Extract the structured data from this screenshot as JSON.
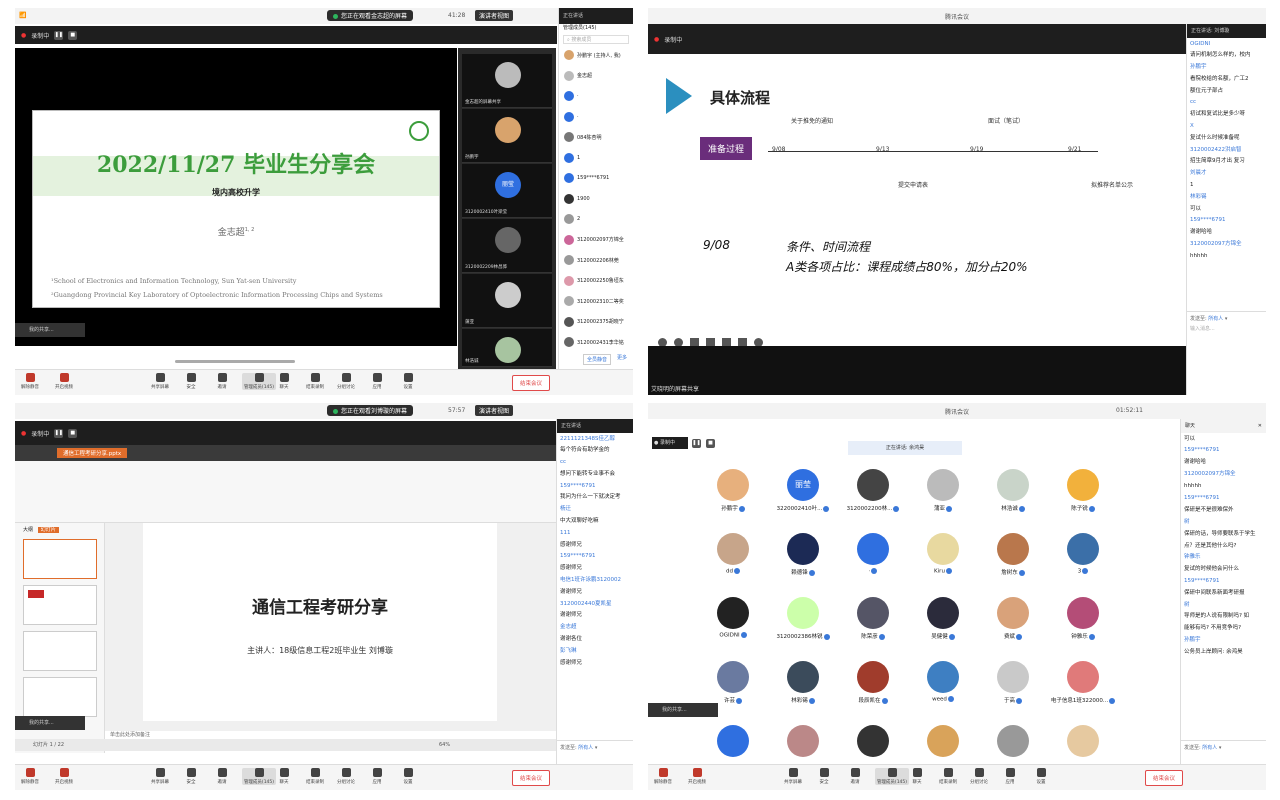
{
  "q1": {
    "share_banner": "您正在观看金志超的屏幕",
    "timer": "41:28",
    "view_btn": "演讲者视图",
    "rec_label": "录制中",
    "slide": {
      "title": "2022/11/27 毕业生分享会",
      "subtitle": "境内高校升学",
      "author": "金志超",
      "author_sup": "1, 2",
      "aff1": "¹School of Electronics and Information Technology, Sun Yat-sen University",
      "aff2": "²Guangdong Provincial Key Laboratory of Optoelectronic Information Processing Chips and Systems"
    },
    "video_names": [
      "金志超的屏幕共享",
      "孙鹏宇",
      "3120002410叶梁莹",
      "3120002209林昌骅",
      "蒲亚",
      "林浩诚"
    ],
    "video_avatar_text": "丽莹",
    "members_title": "管理成员(145)",
    "members_search": "搜索成员",
    "members": [
      "孙鹏宇 (主持人, 我)",
      "金志超",
      "·",
      "·",
      "084陈杏明",
      "1",
      "159****6791",
      "1900",
      "2",
      "3120002097方锦全",
      "3120002206林莞",
      "3120002250鲁垣东",
      "3120002310二等奖",
      "3120002375胡晓宁",
      "3120002431李华铭"
    ],
    "members_btns": [
      "全员静音",
      "更多"
    ],
    "mini_self": "我的共享..."
  },
  "toolbar": {
    "items": [
      "解除静音",
      "开启视频",
      "共享屏幕",
      "安全",
      "邀请",
      "管理成员(145)",
      "聊天",
      "结束录制",
      "分组讨论",
      "应用",
      "设置"
    ],
    "leave": "结束会议"
  },
  "q2": {
    "window_title": "腾讯会议",
    "rec_label": "录制中",
    "heading": "具体流程",
    "prep": "准备过程",
    "dates": [
      "9/08",
      "9/13",
      "9/19",
      "9/21"
    ],
    "events_top": [
      "关于推免的通知",
      "面试（笔试）"
    ],
    "events_bottom": [
      "提交申请表",
      "拟推荐名单公示"
    ],
    "hand_date": "9/08",
    "hand_line1": "条件、时间流程",
    "hand_line2": "A类各项占比：课程成绩占80%，加分占20%",
    "share_note": "艾晓明的屏幕共享",
    "chat_head": "正在讲话: 刘博璇",
    "chat": [
      {
        "t": "OGIDNI",
        "n": true
      },
      {
        "t": "请问机制怎么样的，校内",
        "n": false
      },
      {
        "t": "孙鹏宇",
        "n": true
      },
      {
        "t": "看院校给的名额，广工2",
        "n": false
      },
      {
        "t": "额位元子部占",
        "n": false
      },
      {
        "t": "cc",
        "n": true
      },
      {
        "t": "初试和复试比是多少呀",
        "n": false
      },
      {
        "t": "X",
        "n": true
      },
      {
        "t": "复试什么时候准备呢",
        "n": false
      },
      {
        "t": "3120002422洪启智",
        "n": true
      },
      {
        "t": "招生简章9月才出 复习",
        "n": false
      },
      {
        "t": "刘晨才",
        "n": true
      },
      {
        "t": "1",
        "n": false
      },
      {
        "t": "林彩锡",
        "n": true
      },
      {
        "t": "可以",
        "n": false
      },
      {
        "t": "159****6791",
        "n": true
      },
      {
        "t": "谢谢哈哈",
        "n": false
      },
      {
        "t": "3120002097方锦全",
        "n": true
      },
      {
        "t": "hhhhh",
        "n": false
      }
    ],
    "send_to_label": "发送至:",
    "send_to_value": "所有人",
    "input_placeholder": "输入消息..."
  },
  "q3": {
    "share_banner": "您正在观看刘博璇的屏幕",
    "timer": "57:57",
    "view_btn": "演讲者视图",
    "rec_label": "录制中",
    "file_tab": "通信工程考研分享.pptx",
    "slide_title": "通信工程考研分享",
    "slide_sub": "主讲人：18级信息工程2班毕业生 刘博璇",
    "status_left": "幻灯片 1 / 22",
    "status_zoom": "64%",
    "notes_hint": "单击此处添加备注",
    "thumb_labels": [
      "大纲",
      "幻灯片"
    ],
    "mini_self": "我的共享...",
    "chat_head": "正在讲话",
    "chat": [
      {
        "t": "2211121348S佳乙醇",
        "n": true
      },
      {
        "t": "每个符合有助学金的",
        "n": false
      },
      {
        "t": "cc",
        "n": true
      },
      {
        "t": "想问下能转专业事不会",
        "n": false
      },
      {
        "t": "159****6791",
        "n": true
      },
      {
        "t": "我问为什么一下就决定考",
        "n": false
      },
      {
        "t": "杨迁",
        "n": true
      },
      {
        "t": "中大双聊好吃嘛",
        "n": false
      },
      {
        "t": "111",
        "n": true
      },
      {
        "t": "感谢师兄",
        "n": false
      },
      {
        "t": "159****6791",
        "n": true
      },
      {
        "t": "感谢师兄",
        "n": false
      },
      {
        "t": "电信1班许泳鹏3120002",
        "n": true
      },
      {
        "t": "谢谢师兄",
        "n": false
      },
      {
        "t": "3120002440夏凯星",
        "n": true
      },
      {
        "t": "谢谢师兄",
        "n": false
      },
      {
        "t": "金志超",
        "n": true
      },
      {
        "t": "谢谢各位",
        "n": false
      },
      {
        "t": "彭飞琳",
        "n": true
      },
      {
        "t": "感谢师兄",
        "n": false
      }
    ],
    "send_to_label": "发送至:",
    "send_to_value": "所有人"
  },
  "q4": {
    "window_title": "腾讯会议",
    "timer": "01:52:11",
    "speaker": "正在讲话: 余鸿昊",
    "participants": [
      [
        "孙鹏宇",
        "3220002410叶...",
        "3120002200林...",
        "蒲亚",
        "林浩诚",
        "陈子锐"
      ],
      [
        "dd",
        "赖德锋",
        "·",
        "Kiru",
        "詹树东",
        "3"
      ],
      [
        "OGIDNI",
        "3120002386林锐",
        "陈荣彦",
        "吴健健",
        "费斌",
        "钟雅乐"
      ],
      [
        "许芸",
        "林彩锡",
        "段辰凯在",
        "weed",
        "于高",
        "电子信息1班322000..."
      ]
    ],
    "avatar_text": "丽莹",
    "mini_self": "我的共享...",
    "chat_head": "聊天",
    "chat": [
      {
        "t": "可以",
        "n": false
      },
      {
        "t": "159****6791",
        "n": true
      },
      {
        "t": "谢谢哈哈",
        "n": false
      },
      {
        "t": "3120002097方锦全",
        "n": true
      },
      {
        "t": "hhhhh",
        "n": false
      },
      {
        "t": "",
        "n": false
      },
      {
        "t": "159****6791",
        "n": true
      },
      {
        "t": "保研是不是很难保外",
        "n": false
      },
      {
        "t": "树",
        "n": true
      },
      {
        "t": "保研的话，导师要联系于学生",
        "n": false
      },
      {
        "t": "点？还是其他什么吗?",
        "n": false
      },
      {
        "t": "钟雅乐",
        "n": true
      },
      {
        "t": "复试的时候他会问什么",
        "n": false
      },
      {
        "t": "159****6791",
        "n": true
      },
      {
        "t": "保研中间联系新面考研报",
        "n": false
      },
      {
        "t": "树",
        "n": true
      },
      {
        "t": "导师是的人说有限制吗? 如",
        "n": false
      },
      {
        "t": "能够有吗? 不用竞争吗?",
        "n": false
      },
      {
        "t": "孙鹏宇",
        "n": true
      },
      {
        "t": "公务员上岸顾问: 余鸿昊",
        "n": false
      }
    ],
    "send_to_label": "发送至:",
    "send_to_value": "所有人"
  }
}
